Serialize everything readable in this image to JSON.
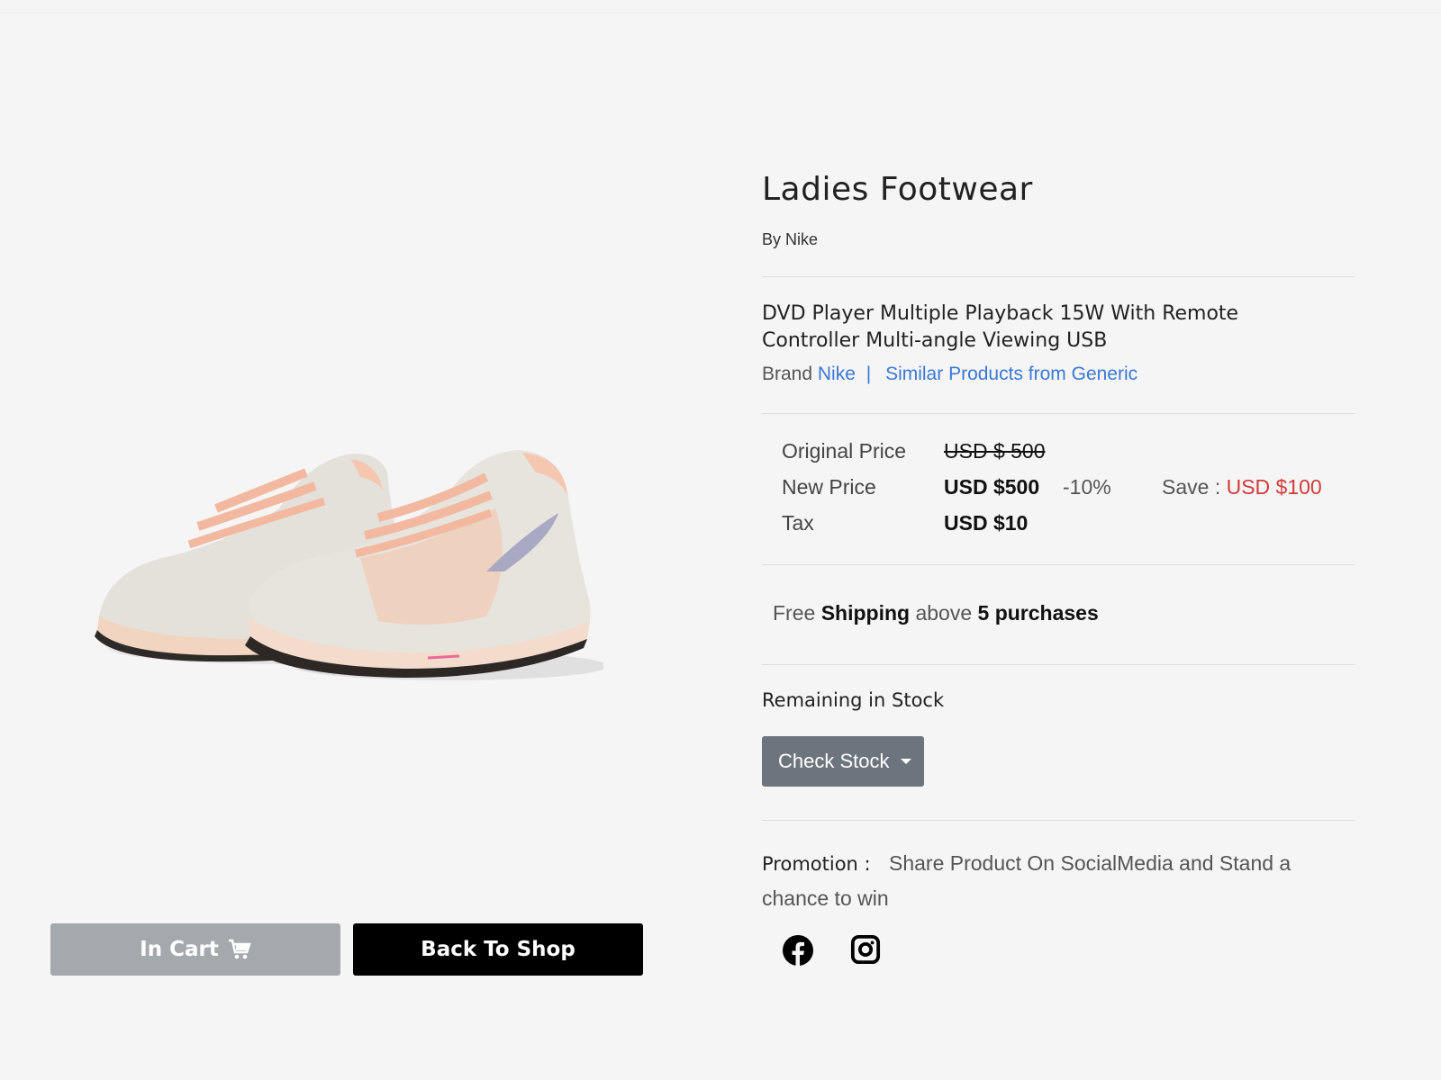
{
  "product": {
    "title": "Ladies Footwear",
    "byline": "By Nike",
    "description": "DVD Player Multiple Playback 15W With Remote Controller Multi-angle Viewing USB",
    "brand_prefix": "Brand",
    "brand_name": "Nike",
    "brand_separator": "|",
    "similar_link": "Similar Products from Generic"
  },
  "pricing": {
    "original_label": "Original Price",
    "original_value": "USD $ 500",
    "new_label": "New Price",
    "new_value": "USD $500",
    "discount": "-10%",
    "save_label": "Save :",
    "save_value": "USD $100",
    "tax_label": "Tax",
    "tax_value": "USD $10"
  },
  "shipping": {
    "part1": "Free",
    "part2": "Shipping",
    "part3": "above",
    "part4": "5 purchases"
  },
  "stock": {
    "label": "Remaining in Stock",
    "button_label": "Check Stock"
  },
  "promotion": {
    "label": "Promotion :",
    "text": "Share Product On SocialMedia and Stand a chance to win"
  },
  "actions": {
    "cart_label": "In Cart",
    "back_label": "Back To Shop"
  },
  "colors": {
    "background": "#f5f5f5",
    "link": "#3a78d6",
    "strike": "#d23a3a",
    "cart_button": "#a5a9ae",
    "back_button": "#000000",
    "stock_button": "#6c757d"
  },
  "icons": [
    "cart-icon",
    "facebook-icon",
    "instagram-icon",
    "caret-down-icon"
  ]
}
